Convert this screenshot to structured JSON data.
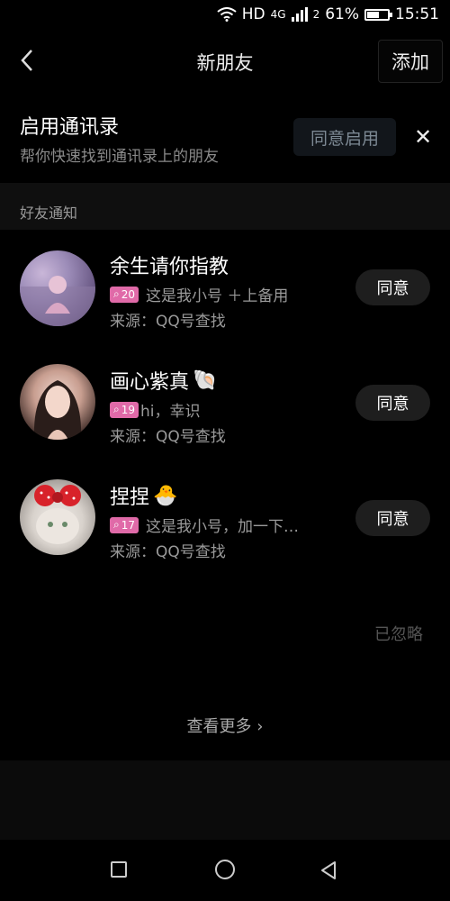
{
  "status": {
    "hd": "HD",
    "net": "4G",
    "sim": "2",
    "battery": "61%",
    "battery_level": 0.61,
    "time": "15:51"
  },
  "nav": {
    "title": "新朋友",
    "add_label": "添加"
  },
  "contacts_banner": {
    "title": "启用通讯录",
    "subtitle": "帮你快速找到通讯录上的朋友",
    "enable_label": "同意启用",
    "close": "✕"
  },
  "section": {
    "title": "好友通知"
  },
  "requests": [
    {
      "name": "余生请你指教",
      "emoji": "",
      "badge": "20",
      "message": "这是我小号  ＋上备用",
      "source": "来源：QQ号查找",
      "action": "同意"
    },
    {
      "name": "画心紫真",
      "emoji": "🐚",
      "badge": "19",
      "message": "hi，幸识",
      "source": "来源：QQ号查找",
      "action": "同意"
    },
    {
      "name": "捏捏",
      "emoji": "🐣",
      "badge": "17",
      "message": "这是我小号，加一下…",
      "source": "来源：QQ号查找",
      "action": "同意"
    }
  ],
  "ignored_label": "已忽略",
  "see_more": {
    "label": "查看更多",
    "chevron": "›"
  },
  "colors": {
    "background": "#000000",
    "badge": "#e06aa8",
    "agree_button": "#1e1e1e",
    "enable_button": "#12161b"
  }
}
